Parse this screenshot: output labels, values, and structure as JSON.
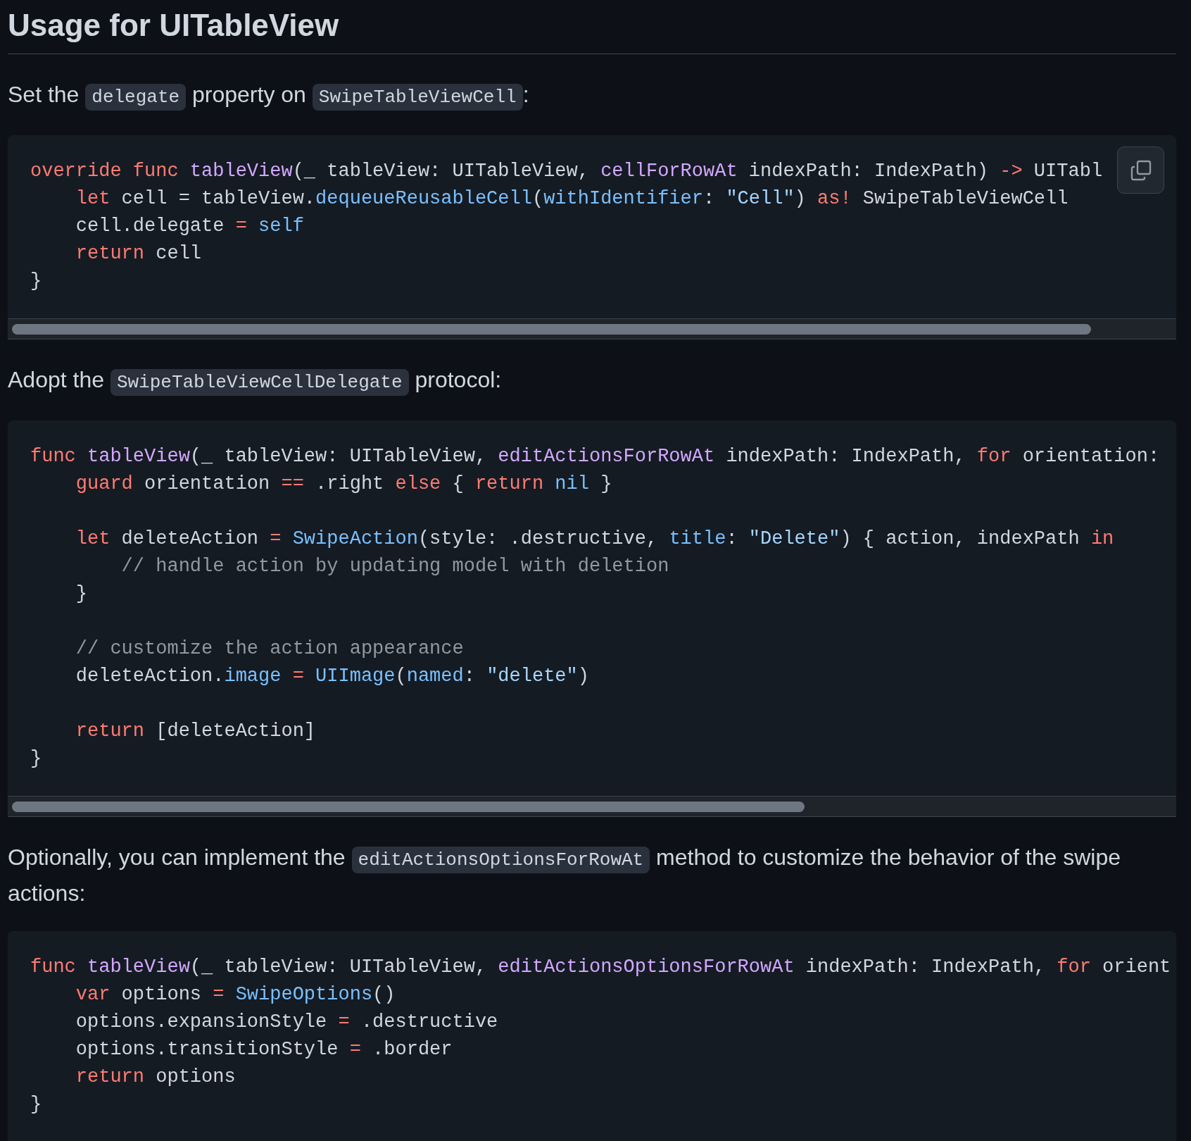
{
  "heading": "Usage for UITableView",
  "sections": [
    {
      "paragraph": [
        {
          "kind": "text",
          "text": "Set the"
        },
        {
          "kind": "code",
          "text": "delegate"
        },
        {
          "kind": "text",
          "text": "property on"
        },
        {
          "kind": "code",
          "text": "SwipeTableViewCell"
        },
        {
          "kind": "text",
          "text": ":"
        }
      ],
      "code_block": {
        "copy_button": true,
        "scrollbar": true,
        "lines": [
          {
            "kind": "code",
            "tokens": [
              {
                "kind": "keyword",
                "text": "override func "
              },
              {
                "kind": "function",
                "text": "tableView"
              },
              {
                "kind": "plain",
                "text": "(_ tableView: UITableView, "
              },
              {
                "kind": "function",
                "text": "cellForRowAt"
              },
              {
                "kind": "plain",
                "text": " indexPath: IndexPath) "
              },
              {
                "kind": "keyword",
                "text": "->"
              },
              {
                "kind": "plain",
                "text": " UITabl"
              }
            ]
          },
          {
            "kind": "code",
            "tokens": [
              {
                "kind": "keyword",
                "text": "    let"
              },
              {
                "kind": "plain",
                "text": " cell = tableView."
              },
              {
                "kind": "builtin",
                "text": "dequeueReusableCell"
              },
              {
                "kind": "plain",
                "text": "("
              },
              {
                "kind": "builtin",
                "text": "withIdentifier"
              },
              {
                "kind": "plain",
                "text": ": "
              },
              {
                "kind": "string",
                "text": "\"Cell\""
              },
              {
                "kind": "plain",
                "text": ") "
              },
              {
                "kind": "keyword",
                "text": "as!"
              },
              {
                "kind": "plain",
                "text": " SwipeTableViewCell"
              }
            ]
          },
          {
            "kind": "code",
            "tokens": [
              {
                "kind": "plain",
                "text": "    cell.delegate "
              },
              {
                "kind": "keyword",
                "text": "="
              },
              {
                "kind": "builtin",
                "text": " self"
              }
            ]
          },
          {
            "kind": "code",
            "tokens": [
              {
                "kind": "keyword",
                "text": "    return"
              },
              {
                "kind": "plain",
                "text": " cell"
              }
            ]
          },
          {
            "kind": "code",
            "tokens": [
              {
                "kind": "plain",
                "text": "}"
              }
            ]
          }
        ]
      }
    },
    {
      "paragraph": [
        {
          "kind": "text",
          "text": "Adopt the"
        },
        {
          "kind": "code",
          "text": "SwipeTableViewCellDelegate"
        },
        {
          "kind": "text",
          "text": "protocol:"
        }
      ],
      "code_block": {
        "copy_button": false,
        "scrollbar": true,
        "lines": [
          {
            "kind": "code",
            "tokens": [
              {
                "kind": "keyword",
                "text": "func "
              },
              {
                "kind": "function",
                "text": "tableView"
              },
              {
                "kind": "plain",
                "text": "(_ tableView: UITableView, "
              },
              {
                "kind": "function",
                "text": "editActionsForRowAt"
              },
              {
                "kind": "plain",
                "text": " indexPath: IndexPath, "
              },
              {
                "kind": "keyword",
                "text": "for"
              },
              {
                "kind": "plain",
                "text": " orientation:"
              }
            ]
          },
          {
            "kind": "code",
            "tokens": [
              {
                "kind": "keyword",
                "text": "    guard"
              },
              {
                "kind": "plain",
                "text": " orientation "
              },
              {
                "kind": "keyword",
                "text": "=="
              },
              {
                "kind": "plain",
                "text": " .right "
              },
              {
                "kind": "keyword",
                "text": "else"
              },
              {
                "kind": "plain",
                "text": " { "
              },
              {
                "kind": "keyword",
                "text": "return"
              },
              {
                "kind": "builtin",
                "text": " nil"
              },
              {
                "kind": "plain",
                "text": " }"
              }
            ]
          },
          {
            "kind": "blank"
          },
          {
            "kind": "code",
            "tokens": [
              {
                "kind": "keyword",
                "text": "    let"
              },
              {
                "kind": "plain",
                "text": " deleteAction "
              },
              {
                "kind": "keyword",
                "text": "="
              },
              {
                "kind": "builtin",
                "text": " SwipeAction"
              },
              {
                "kind": "plain",
                "text": "(style: .destructive, "
              },
              {
                "kind": "builtin",
                "text": "title"
              },
              {
                "kind": "plain",
                "text": ": "
              },
              {
                "kind": "string",
                "text": "\"Delete\""
              },
              {
                "kind": "plain",
                "text": ") { action, indexPath "
              },
              {
                "kind": "keyword",
                "text": "in"
              }
            ]
          },
          {
            "kind": "code",
            "tokens": [
              {
                "kind": "comment",
                "text": "        // handle action by updating model with deletion"
              }
            ]
          },
          {
            "kind": "code",
            "tokens": [
              {
                "kind": "plain",
                "text": "    }"
              }
            ]
          },
          {
            "kind": "blank"
          },
          {
            "kind": "code",
            "tokens": [
              {
                "kind": "comment",
                "text": "    // customize the action appearance"
              }
            ]
          },
          {
            "kind": "code",
            "tokens": [
              {
                "kind": "plain",
                "text": "    deleteAction."
              },
              {
                "kind": "builtin",
                "text": "image"
              },
              {
                "kind": "keyword",
                "text": " ="
              },
              {
                "kind": "builtin",
                "text": " UIImage"
              },
              {
                "kind": "plain",
                "text": "("
              },
              {
                "kind": "builtin",
                "text": "named"
              },
              {
                "kind": "plain",
                "text": ": "
              },
              {
                "kind": "string",
                "text": "\"delete\""
              },
              {
                "kind": "plain",
                "text": ")"
              }
            ]
          },
          {
            "kind": "blank"
          },
          {
            "kind": "code",
            "tokens": [
              {
                "kind": "keyword",
                "text": "    return"
              },
              {
                "kind": "plain",
                "text": " [deleteAction]"
              }
            ]
          },
          {
            "kind": "code",
            "tokens": [
              {
                "kind": "plain",
                "text": "}"
              }
            ]
          }
        ]
      }
    },
    {
      "paragraph": [
        {
          "kind": "text",
          "text": "Optionally, you can implement the"
        },
        {
          "kind": "code",
          "text": "editActionsOptionsForRowAt"
        },
        {
          "kind": "text",
          "text": "method to customize the behavior of the swipe actions:"
        }
      ],
      "code_block": {
        "copy_button": false,
        "scrollbar": false,
        "lines": [
          {
            "kind": "code",
            "tokens": [
              {
                "kind": "keyword",
                "text": "func "
              },
              {
                "kind": "function",
                "text": "tableView"
              },
              {
                "kind": "plain",
                "text": "(_ tableView: UITableView, "
              },
              {
                "kind": "function",
                "text": "editActionsOptionsForRowAt"
              },
              {
                "kind": "plain",
                "text": " indexPath: IndexPath, "
              },
              {
                "kind": "keyword",
                "text": "for"
              },
              {
                "kind": "plain",
                "text": " orient"
              }
            ]
          },
          {
            "kind": "code",
            "tokens": [
              {
                "kind": "keyword",
                "text": "    var"
              },
              {
                "kind": "plain",
                "text": " options "
              },
              {
                "kind": "keyword",
                "text": "="
              },
              {
                "kind": "builtin",
                "text": " SwipeOptions"
              },
              {
                "kind": "plain",
                "text": "()"
              }
            ]
          },
          {
            "kind": "code",
            "tokens": [
              {
                "kind": "plain",
                "text": "    options.expansionStyle "
              },
              {
                "kind": "keyword",
                "text": "="
              },
              {
                "kind": "plain",
                "text": " .destructive"
              }
            ]
          },
          {
            "kind": "code",
            "tokens": [
              {
                "kind": "plain",
                "text": "    options.transitionStyle "
              },
              {
                "kind": "keyword",
                "text": "="
              },
              {
                "kind": "plain",
                "text": " .border"
              }
            ]
          },
          {
            "kind": "code",
            "tokens": [
              {
                "kind": "keyword",
                "text": "    return"
              },
              {
                "kind": "plain",
                "text": " options"
              }
            ]
          },
          {
            "kind": "code",
            "tokens": [
              {
                "kind": "plain",
                "text": "}"
              }
            ]
          }
        ]
      }
    }
  ]
}
